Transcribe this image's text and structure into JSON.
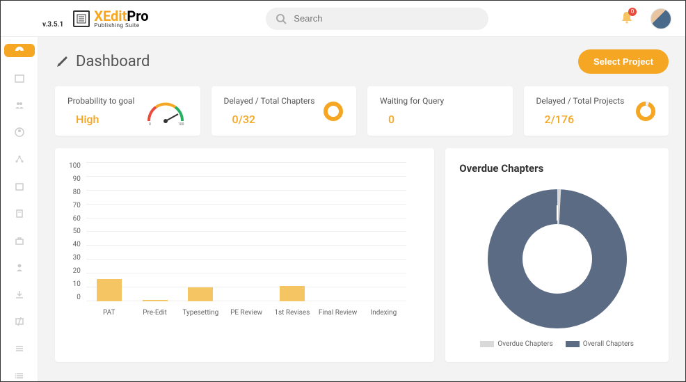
{
  "app": {
    "name_part1": "XEdit",
    "name_part2": "Pro",
    "tagline": "Publishing Suite",
    "version": "v.3.5.1"
  },
  "search": {
    "placeholder": "Search"
  },
  "notifications": {
    "count": "0"
  },
  "page": {
    "title": "Dashboard",
    "select_project_label": "Select Project"
  },
  "cards": {
    "probability": {
      "title": "Probability to goal",
      "value": "High"
    },
    "delayed_chapters": {
      "title": "Delayed / Total Chapters",
      "value": "0/32"
    },
    "waiting_query": {
      "title": "Waiting for Query",
      "value": "0"
    },
    "delayed_projects": {
      "title": "Delayed / Total Projects",
      "value": "2/176"
    }
  },
  "overdue": {
    "title": "Overdue Chapters",
    "legend_overdue": "Overdue Chapters",
    "legend_overall": "Overall Chapters"
  },
  "chart_data": [
    {
      "type": "bar",
      "categories": [
        "PAT",
        "Pre-Edit",
        "Typesetting",
        "PE Review",
        "1st Revises",
        "Final Review",
        "Indexing"
      ],
      "values": [
        16,
        1,
        10,
        0,
        11,
        0,
        0
      ],
      "ylabel": "",
      "xlabel": "",
      "ylim": [
        0,
        100
      ],
      "yticks": [
        0,
        10,
        20,
        30,
        40,
        50,
        60,
        70,
        80,
        90,
        100
      ]
    },
    {
      "type": "pie",
      "title": "Overdue Chapters",
      "series": [
        {
          "name": "Overdue Chapters",
          "value": 1,
          "color": "#d9d9d9"
        },
        {
          "name": "Overall Chapters",
          "value": 99,
          "color": "#5c6b84"
        }
      ]
    }
  ]
}
